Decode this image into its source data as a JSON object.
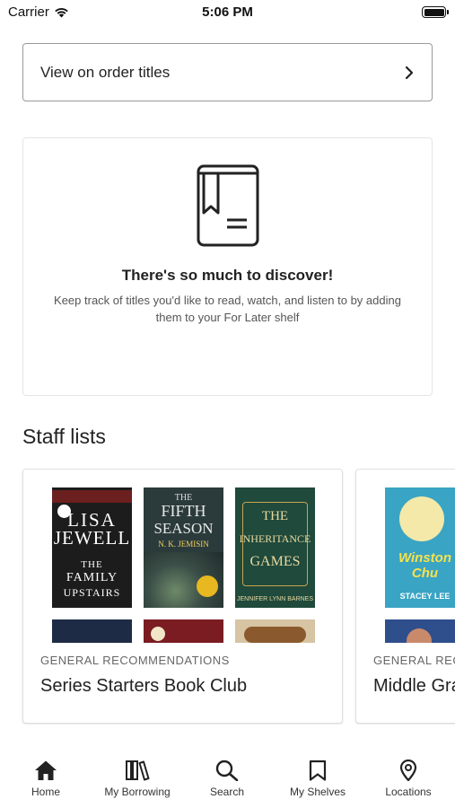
{
  "status_bar": {
    "carrier": "Carrier",
    "time": "5:06 PM"
  },
  "order_titles": {
    "label": "View on order titles"
  },
  "empty_state": {
    "title": "There's so much to discover!",
    "description": "Keep track of titles you'd like to read, watch, and listen to by adding them to your For Later shelf"
  },
  "staff_lists": {
    "heading": "Staff lists",
    "cards": [
      {
        "category": "GENERAL RECOMMENDATIONS",
        "title": "Series Starters Book Club",
        "covers": [
          {
            "lines": [
              "LISA",
              "JEWELL",
              "THE",
              "FAMILY",
              "UPSTAIRS"
            ],
            "bg": "#1c1c1c"
          },
          {
            "lines": [
              "THE",
              "FIFTH",
              "SEASON",
              "N. K. JEMISIN"
            ],
            "bg": "#2b3b3c"
          },
          {
            "lines": [
              "THE",
              "INHERITANCE",
              "GAMES",
              "JENNIFER LYNN BARNES"
            ],
            "bg": "#1f4a3c"
          }
        ]
      },
      {
        "category": "GENERAL RECOMMENDATIONS",
        "title": "Middle Grade",
        "covers": [
          {
            "lines": [
              "Winston Chu",
              "STACEY LEE"
            ],
            "bg": "#3aa4c4"
          }
        ]
      }
    ]
  },
  "tabs": [
    {
      "label": "Home",
      "icon": "home-icon"
    },
    {
      "label": "My Borrowing",
      "icon": "books-icon"
    },
    {
      "label": "Search",
      "icon": "search-icon"
    },
    {
      "label": "My Shelves",
      "icon": "bookmark-icon"
    },
    {
      "label": "Locations",
      "icon": "location-pin-icon"
    }
  ]
}
